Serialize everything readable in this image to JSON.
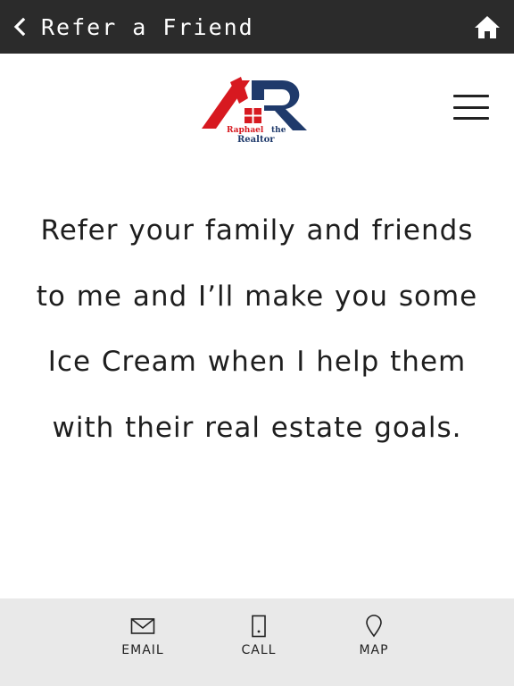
{
  "topbar": {
    "title": "Refer a Friend",
    "back_icon": "chevron-left-icon",
    "home_icon": "home-icon",
    "bg_color": "#2b2b2b"
  },
  "header": {
    "logo": {
      "name_left": "Raphael",
      "name_right": "the",
      "name_bottom": "Realtor",
      "colors": {
        "red": "#d71920",
        "navy": "#1f3a6b"
      }
    },
    "menu_icon": "hamburger-menu-icon"
  },
  "main": {
    "message": "Refer your family and friends to me and I’ll make you some Ice Cream when I help them with their real estate goals."
  },
  "bottom_nav": {
    "items": [
      {
        "label": "EMAIL",
        "icon": "envelope-icon"
      },
      {
        "label": "CALL",
        "icon": "phone-icon"
      },
      {
        "label": "MAP",
        "icon": "map-pin-icon"
      }
    ],
    "bg_color": "#e9e9e9"
  }
}
